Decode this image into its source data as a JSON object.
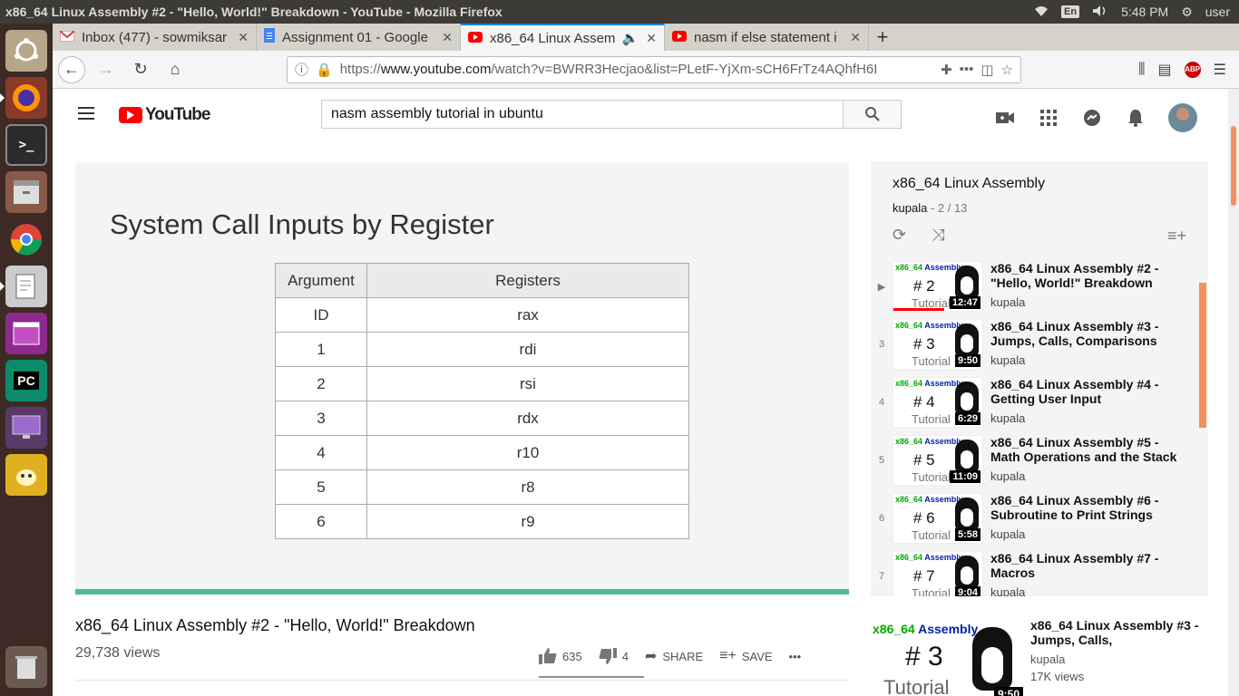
{
  "os": {
    "window_title": "x86_64 Linux Assembly #2 - \"Hello, World!\" Breakdown - YouTube - Mozilla Firefox",
    "keyboard": "En",
    "clock": "5:48 PM",
    "user": "user"
  },
  "launcher": {
    "apps": [
      "Ubuntu dash",
      "Firefox",
      "Terminal",
      "Files",
      "Chromium",
      "Text Editor",
      "Window app",
      "PyCharm",
      "Display",
      "Teapot app"
    ],
    "pycharm_label": "PC"
  },
  "tabs": [
    {
      "label": "Inbox (477) - sowmiksar",
      "icon": "gmail-icon"
    },
    {
      "label": "Assignment 01 - Google",
      "icon": "docs-icon"
    },
    {
      "label": "x86_64 Linux Assembl",
      "icon": "youtube-icon",
      "active": true
    },
    {
      "label": "nasm if else statement i",
      "icon": "youtube-icon"
    }
  ],
  "url": {
    "scheme": "https://",
    "host": "www.youtube.com",
    "path": "/watch?v=BWRR3Hecjao&list=PLetF-YjXm-sCH6FrTz4AQhfH6I"
  },
  "youtube": {
    "logo": "YouTube",
    "search_value": "nasm assembly tutorial in ubuntu"
  },
  "slide": {
    "title": "System Call Inputs by Register",
    "headers": [
      "Argument",
      "Registers"
    ],
    "rows": [
      [
        "ID",
        "rax"
      ],
      [
        "1",
        "rdi"
      ],
      [
        "2",
        "rsi"
      ],
      [
        "3",
        "rdx"
      ],
      [
        "4",
        "r10"
      ],
      [
        "5",
        "r8"
      ],
      [
        "6",
        "r9"
      ]
    ]
  },
  "video": {
    "title": "x86_64 Linux Assembly #2 - \"Hello, World!\" Breakdown",
    "views": "29,738 views",
    "likes": "635",
    "dislikes": "4",
    "share": "SHARE",
    "save": "SAVE",
    "more": "•••"
  },
  "playlist": {
    "title": "x86_64 Linux Assembly",
    "channel": "kupala",
    "position": "2 / 13",
    "items": [
      {
        "index": "▶",
        "num": "# 2",
        "duration": "12:47",
        "title": "x86_64 Linux Assembly #2 - \"Hello, World!\" Breakdown",
        "channel": "kupala"
      },
      {
        "index": "3",
        "num": "# 3",
        "duration": "9:50",
        "title": "x86_64 Linux Assembly #3 - Jumps, Calls, Comparisons",
        "channel": "kupala"
      },
      {
        "index": "4",
        "num": "# 4",
        "duration": "6:29",
        "title": "x86_64 Linux Assembly #4 - Getting User Input",
        "channel": "kupala"
      },
      {
        "index": "5",
        "num": "# 5",
        "duration": "11:09",
        "title": "x86_64 Linux Assembly #5 - Math Operations and the Stack",
        "channel": "kupala"
      },
      {
        "index": "6",
        "num": "# 6",
        "duration": "5:58",
        "title": "x86_64 Linux Assembly #6 - Subroutine to Print Strings",
        "channel": "kupala"
      },
      {
        "index": "7",
        "num": "# 7",
        "duration": "9:04",
        "title": "x86_64 Linux Assembly #7 - Macros",
        "channel": "kupala"
      }
    ],
    "thumb_label_a": "x86_64",
    "thumb_label_b": "Assembly",
    "thumb_tut": "Tutorial"
  },
  "related": {
    "title": "x86_64 Linux Assembly #3 - Jumps, Calls,",
    "channel": "kupala",
    "views": "17K views",
    "num": "# 3",
    "duration": "9:50"
  },
  "colors": {
    "accent": "#ff0000",
    "progress": "#4dbd8f",
    "launcher_bg": "#3d2a24"
  }
}
